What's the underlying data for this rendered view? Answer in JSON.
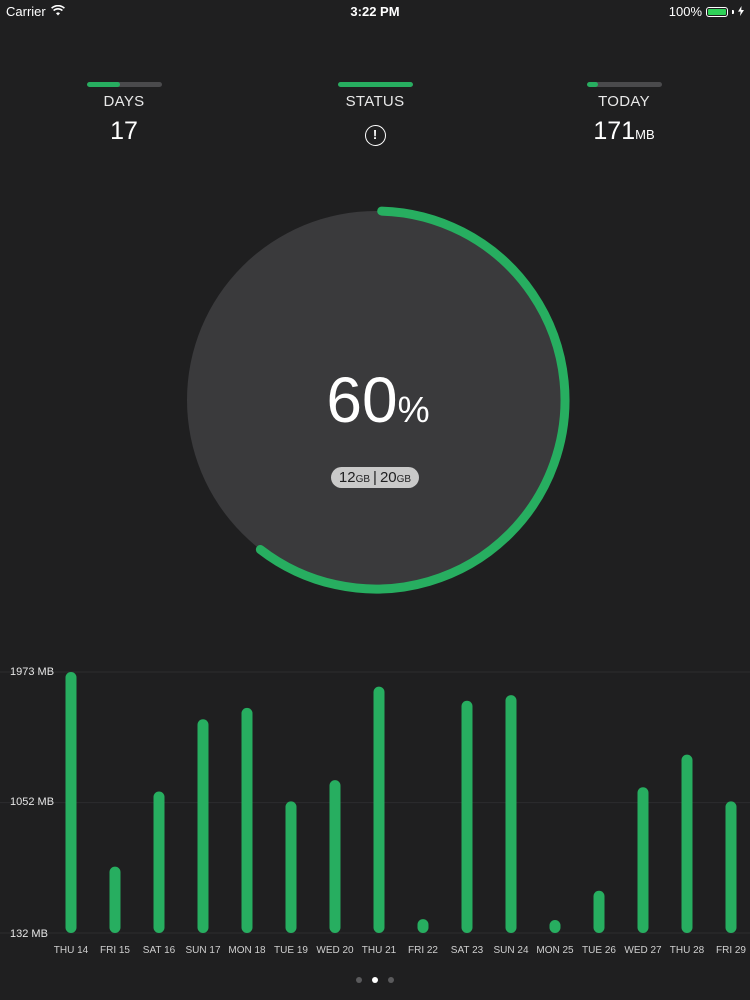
{
  "status_bar": {
    "carrier": "Carrier",
    "time": "3:22 PM",
    "battery": "100%",
    "battery_level": 1.0
  },
  "stats": {
    "days": {
      "label": "DAYS",
      "value": "17",
      "bar_fill": 0.45
    },
    "status": {
      "label": "STATUS",
      "icon": "!",
      "bar_fill": 1.0
    },
    "today": {
      "label": "TODAY",
      "value": "171",
      "unit": "MB",
      "bar_fill": 0.15
    }
  },
  "gauge": {
    "percent": "60",
    "percent_sign": "%",
    "used": "12",
    "used_unit": "GB",
    "separator": "|",
    "total": "20",
    "total_unit": "GB",
    "fraction": 0.6
  },
  "colors": {
    "accent": "#27ae60",
    "background": "#1f1f20",
    "gauge_fill": "#3a3a3c"
  },
  "chart_data": {
    "type": "bar",
    "categories": [
      "THU 14",
      "FRI 15",
      "SAT 16",
      "SUN 17",
      "MON 18",
      "TUE 19",
      "WED 20",
      "THU 21",
      "FRI 22",
      "SAT 23",
      "SUN 24",
      "MON 25",
      "TUE 26",
      "WED 27",
      "THU 28",
      "FRI 29"
    ],
    "values": [
      1973,
      600,
      1130,
      1640,
      1720,
      1060,
      1210,
      1870,
      230,
      1770,
      1810,
      180,
      430,
      1160,
      1390,
      1060
    ],
    "ylim": [
      132,
      1973
    ],
    "yticks": [
      "1973 MB",
      "1052  MB",
      "132 MB"
    ],
    "ytick_values": [
      1973,
      1052,
      132
    ],
    "grid": true
  },
  "pager": {
    "count": 3,
    "active": 1
  }
}
